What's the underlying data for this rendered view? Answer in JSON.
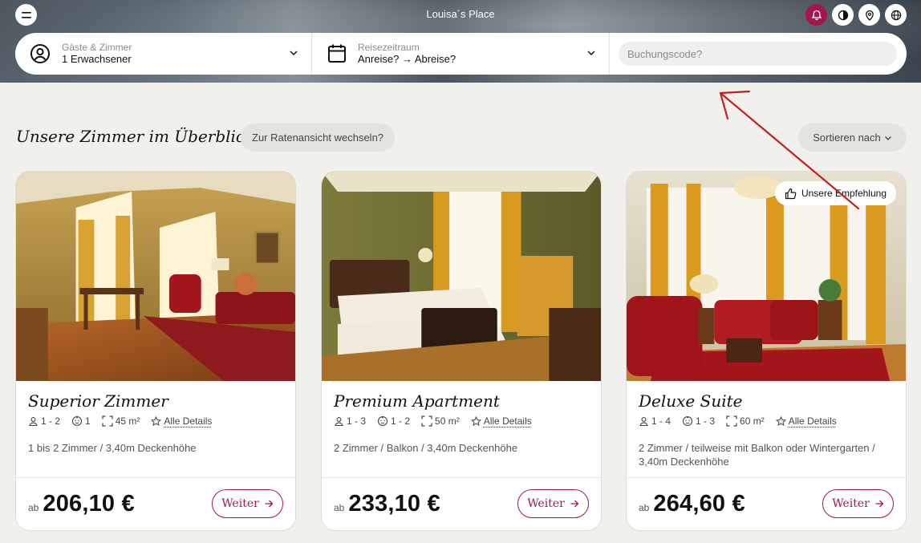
{
  "header": {
    "title": "Louisa´s Place",
    "icons": [
      "menu-icon",
      "bell-icon",
      "contrast-icon",
      "location-pin-icon",
      "globe-icon"
    ],
    "accent": "#a3174f"
  },
  "search": {
    "guests_label": "Gäste & Zimmer",
    "guests_value": "1 Erwachsener",
    "dates_label": "Reisezeitraum",
    "dates_value": "Anreise? → Abreise?",
    "code_placeholder": "Buchungscode?"
  },
  "section": {
    "title": "Unsere Zimmer im Überblick",
    "rates_toggle": "Zur Ratenansicht wechseln?",
    "sort_label": "Sortieren nach"
  },
  "rooms": [
    {
      "name": "Superior Zimmer",
      "persons": "1 - 2",
      "kids": "1",
      "size": "45 m²",
      "details": "Alle Details",
      "desc": "1 bis 2 Zimmer / 3,40m Deckenhöhe",
      "price_prefix": "ab",
      "price": "206,10 €",
      "button": "Weiter"
    },
    {
      "name": "Premium Apartment",
      "persons": "1 - 3",
      "kids": "1 - 2",
      "size": "50 m²",
      "details": "Alle Details",
      "desc": "2 Zimmer / Balkon / 3,40m Deckenhöhe",
      "price_prefix": "ab",
      "price": "233,10 €",
      "button": "Weiter"
    },
    {
      "name": "Deluxe Suite",
      "persons": "1 - 4",
      "kids": "1 - 3",
      "size": "60 m²",
      "details": "Alle Details",
      "desc": "2 Zimmer / teilweise mit Balkon oder Wintergarten / 3,40m Deckenhöhe",
      "price_prefix": "ab",
      "price": "264,60 €",
      "button": "Weiter",
      "badge": "Unsere Empfehlung"
    }
  ]
}
